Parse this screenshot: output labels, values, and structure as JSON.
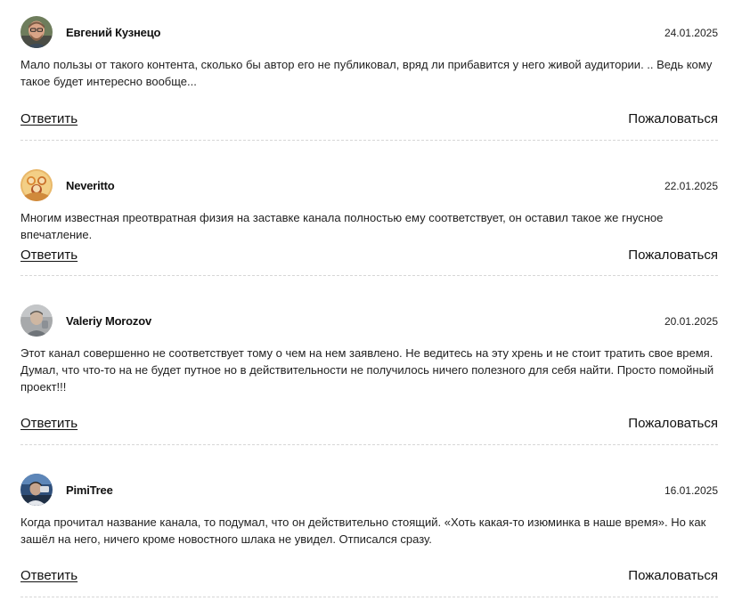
{
  "comments": [
    {
      "author": "Евгений Кузнецо",
      "date": "24.01.2025",
      "text": "Мало пользы от такого контента, сколько бы автор его не публиковал, вряд ли прибавится у него живой аудитории. .. Ведь кому такое будет интересно вообще...",
      "reply_label": "Ответить",
      "report_label": "Пожаловаться",
      "avatar_icon": "user-photo-avatar"
    },
    {
      "author": "Neveritto",
      "date": "22.01.2025",
      "text": "Многим известная преотвратная физия на заставке канала полностью ему соответствует, он оставил такое же гнусное впечатление.",
      "reply_label": "Ответить",
      "report_label": "Пожаловаться",
      "avatar_icon": "user-illustration-avatar"
    },
    {
      "author": "Valeriy Morozov",
      "date": "20.01.2025",
      "text": "Этот канал совершенно не соответствует тому о чем на нем заявлено. Не ведитесь на эту хрень и не стоит тратить свое время. Думал, что что-то на не будет путное но в действительности не получилось ничего полезного для себя найти. Просто помойный проект!!!",
      "reply_label": "Ответить",
      "report_label": "Пожаловаться",
      "avatar_icon": "user-photo-avatar"
    },
    {
      "author": "PimiTree",
      "date": "16.01.2025",
      "text": "Когда прочитал название канала, то подумал, что он действительно стоящий. «Хоть какая-то изюминка в наше время». Но как зашёл на него, ничего кроме новостного шлака не увидел. Отписался сразу.",
      "reply_label": "Ответить",
      "report_label": "Пожаловаться",
      "avatar_icon": "user-photo-avatar"
    }
  ]
}
